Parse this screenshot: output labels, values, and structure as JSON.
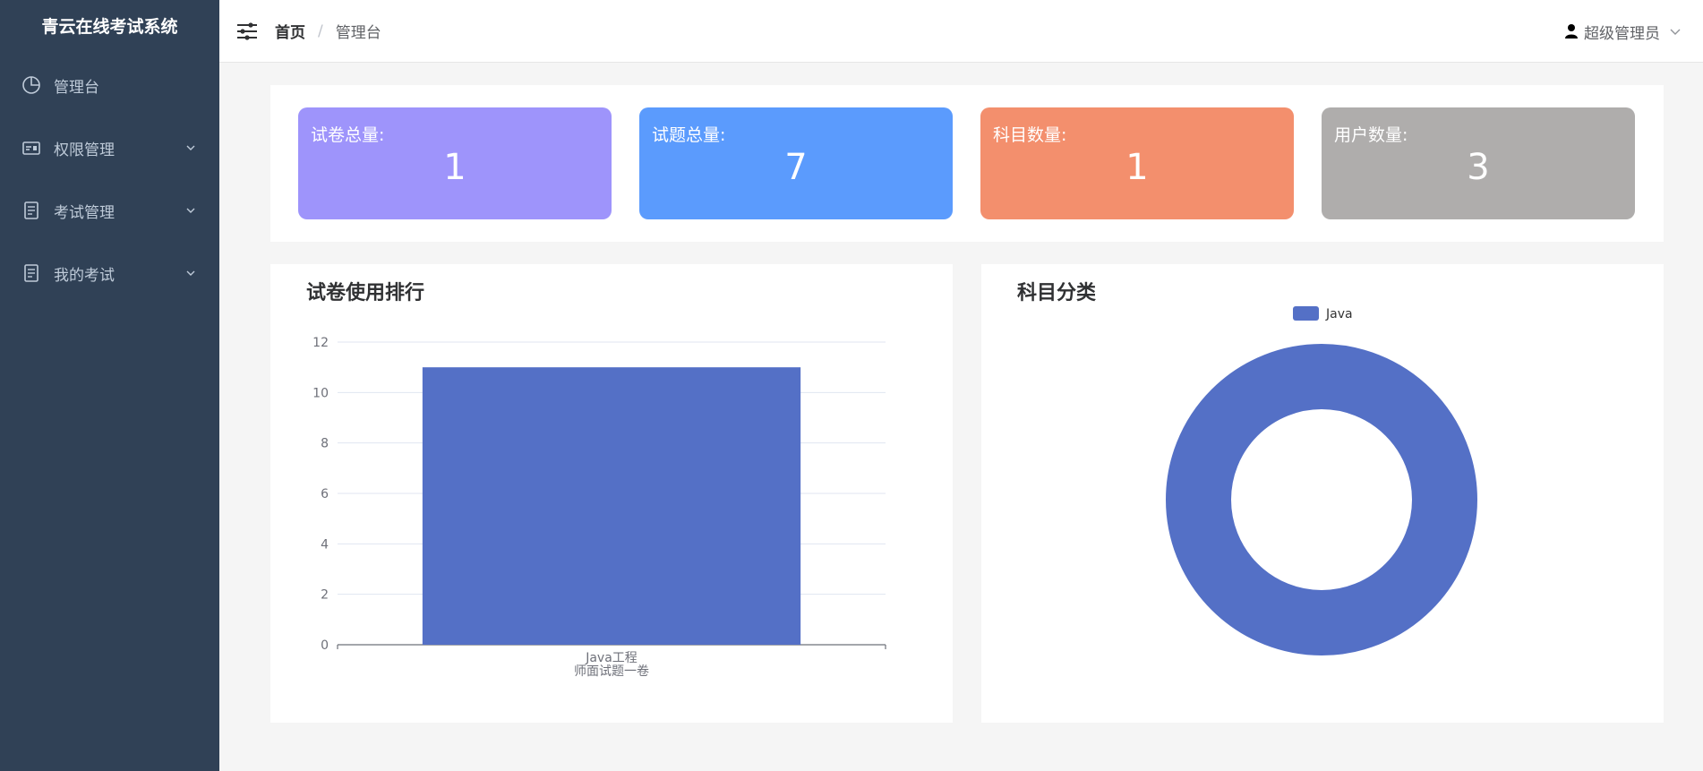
{
  "app": {
    "title": "青云在线考试系统"
  },
  "sidebar": {
    "items": [
      {
        "label": "管理台",
        "icon": "pie-chart-icon",
        "expandable": false
      },
      {
        "label": "权限管理",
        "icon": "id-card-icon",
        "expandable": true
      },
      {
        "label": "考试管理",
        "icon": "document-icon",
        "expandable": true
      },
      {
        "label": "我的考试",
        "icon": "document-icon",
        "expandable": true
      }
    ]
  },
  "header": {
    "breadcrumb": {
      "home": "首页",
      "separator": "/",
      "current": "管理台"
    },
    "user": {
      "name": "超级管理员",
      "icon": "user-icon"
    }
  },
  "stats": [
    {
      "label": "试卷总量:",
      "value": "1",
      "color": "#9e94fb"
    },
    {
      "label": "试题总量:",
      "value": "7",
      "color": "#5b9bfd"
    },
    {
      "label": "科目数量:",
      "value": "1",
      "color": "#f38f6d"
    },
    {
      "label": "用户数量:",
      "value": "3",
      "color": "#afadac"
    }
  ],
  "panels": {
    "bar_title": "试卷使用排行",
    "pie_title": "科目分类"
  },
  "colors": {
    "sidebar_bg": "#304156",
    "series": "#5470c6"
  },
  "chart_data": [
    {
      "type": "bar",
      "title": "试卷使用排行",
      "categories": [
        "Java工程\n师面试题一卷"
      ],
      "values": [
        11
      ],
      "ylim": [
        0,
        12
      ],
      "yticks": [
        0,
        2,
        4,
        6,
        8,
        10,
        12
      ],
      "grid": true,
      "legend": "none"
    },
    {
      "type": "pie",
      "title": "科目分类",
      "donut": true,
      "labels": [
        "Java"
      ],
      "values": [
        1
      ],
      "legend": "top-center"
    }
  ]
}
